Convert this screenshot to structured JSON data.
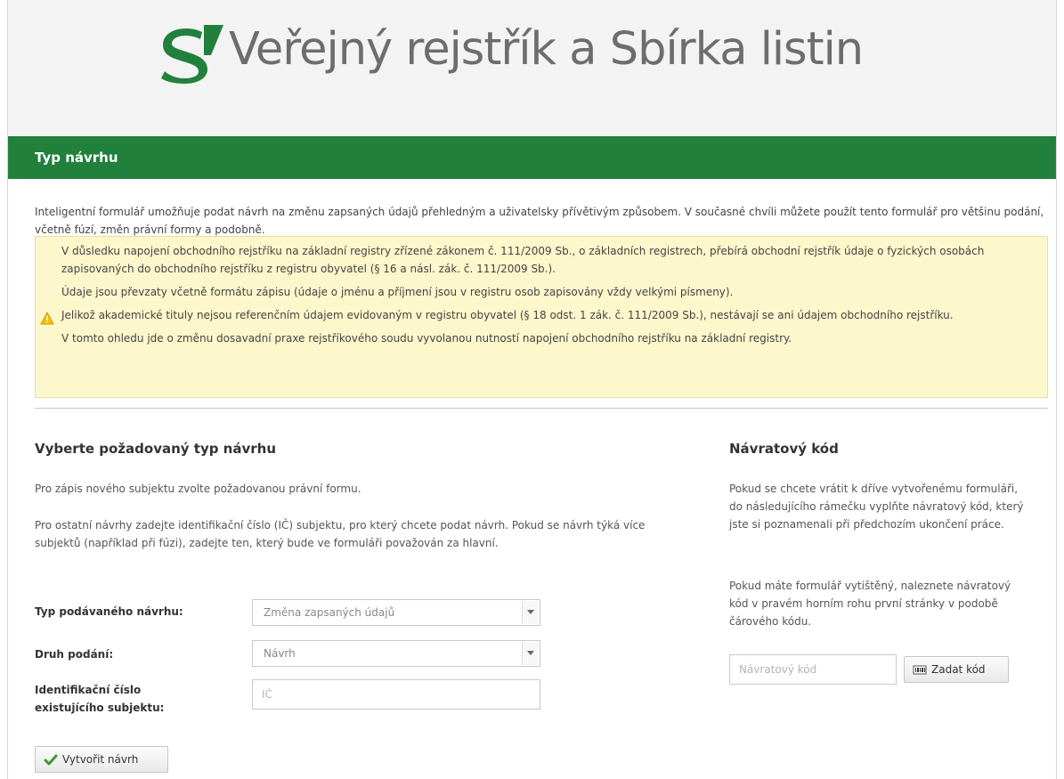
{
  "header": {
    "title": "Veřejný rejstřík a Sbírka listin",
    "brand_color": "#22803d"
  },
  "section_title": "Typ návrhu",
  "intro": "Inteligentní formulář umožňuje podat návrh na změnu zapsaných údajů přehledným a uživatelsky přívětivým způsobem. V současné chvíli můžete použít tento formulář pro většinu podání, včetně fúzí, změn právní formy a podobně.",
  "warning": {
    "icon": "warning-icon",
    "paragraphs": [
      "V důsledku napojení obchodního rejstříku na základní registry zřízené zákonem č. 111/2009 Sb., o základních registrech, přebírá obchodní rejstřík údaje o fyzických osobách zapisovaných do obchodního rejstříku z registru obyvatel (§ 16 a násl. zák. č. 111/2009 Sb.).",
      "Údaje jsou převzaty včetně formátu zápisu (údaje o jménu a příjmení jsou v registru osob zapisovány vždy velkými písmeny).",
      "Jelikož akademické tituly nejsou referenčním údajem evidovaným v registru obyvatel (§ 18 odst. 1 zák. č. 111/2009 Sb.), nestávají se ani údajem obchodního rejstříku.",
      "V tomto ohledu jde o změnu dosavadní praxe rejstříkového soudu vyvolanou nutností napojení obchodního rejstříku na základní registry."
    ]
  },
  "left": {
    "heading": "Vyberte požadovaný typ návrhu",
    "p1": "Pro zápis nového subjektu zvolte požadovanou právní formu.",
    "p2": "Pro ostatní návrhy zadejte identifikační číslo (IČ) subjektu, pro který chcete podat návrh. Pokud se návrh týká více subjektů (například při fúzi), zadejte ten, který bude ve formuláři považován za hlavní.",
    "form": {
      "type_label": "Typ podávaného návrhu:",
      "type_value": "Změna zapsaných údajů",
      "kind_label": "Druh podání:",
      "kind_value": "Návrh",
      "id_label": "Identifikační číslo existujícího subjektu:",
      "id_placeholder": "IČ"
    },
    "create_button": "Vytvořit návrh"
  },
  "right": {
    "heading": "Návratový kód",
    "p1": "Pokud se chcete vrátit k dříve vytvořenému formuláři, do následujícího rámečku vyplňte návratový kód, který jste si poznamenali při předchozím ukončení práce.",
    "p2": "Pokud máte formulář vytištěný, naleznete návratový kód v pravém horním rohu první stránky v podobě čárového kódu.",
    "code_placeholder": "Návratový kód",
    "code_button": "Zadat kód"
  }
}
